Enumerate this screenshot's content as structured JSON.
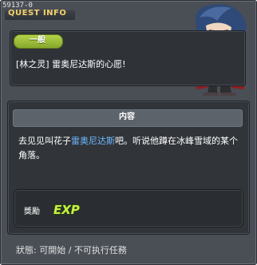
{
  "window": {
    "quest_id": "59137-0",
    "title": "QUEST INFO"
  },
  "quest": {
    "category": "一般",
    "name": "[林之灵] 雷奥尼达斯的心愿!"
  },
  "details": {
    "header": "内容",
    "description_before": "去见见叫花子",
    "description_highlight": "雷奥尼达斯",
    "description_after": "吧。听说他蹲在冰峰雪域的某个角落。"
  },
  "reward": {
    "label": "獎勵",
    "exp_text": "EXP"
  },
  "status": {
    "text": "狀態: 可開始 / 不可执行任務"
  },
  "colors": {
    "title": "#f3d36a",
    "category_pill": "#9cbf38",
    "highlight": "#6fb8ff",
    "exp": "#c8f040"
  },
  "icons": {
    "portrait": "npc-portrait",
    "exp": "exp-icon"
  }
}
